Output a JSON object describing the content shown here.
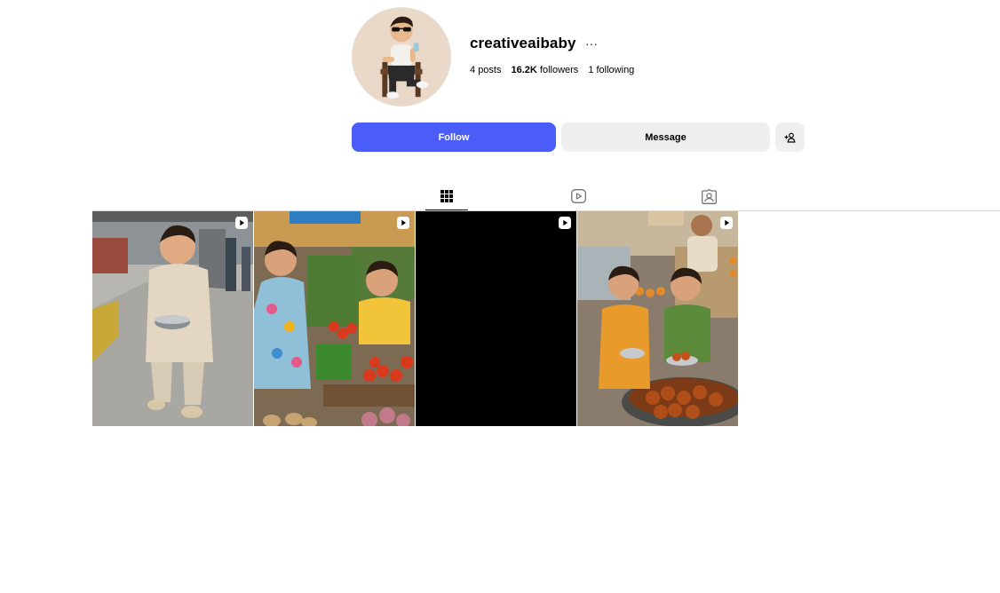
{
  "profile": {
    "username": "creativeaibaby",
    "more_icon": "more-horizontal-icon",
    "stats": {
      "posts_count": "4",
      "posts_label": "posts",
      "followers_count": "16.2K",
      "followers_label": "followers",
      "following_count": "1",
      "following_label": "following"
    }
  },
  "actions": {
    "follow_label": "Follow",
    "message_label": "Message",
    "add_user_icon": "add-user-icon"
  },
  "tabs": [
    {
      "name": "posts",
      "icon": "grid-icon",
      "active": true
    },
    {
      "name": "reels",
      "icon": "reels-icon",
      "active": false
    },
    {
      "name": "tagged",
      "icon": "tagged-icon",
      "active": false
    }
  ],
  "posts": [
    {
      "type": "reel",
      "description": "toddler at railway platform"
    },
    {
      "type": "reel",
      "description": "children at vegetable market"
    },
    {
      "type": "reel",
      "description": "black thumbnail"
    },
    {
      "type": "reel",
      "description": "children at sweet shop"
    }
  ],
  "colors": {
    "accent": "#4a5df9",
    "button_secondary": "#efefef",
    "divider": "#dbdbdb"
  }
}
